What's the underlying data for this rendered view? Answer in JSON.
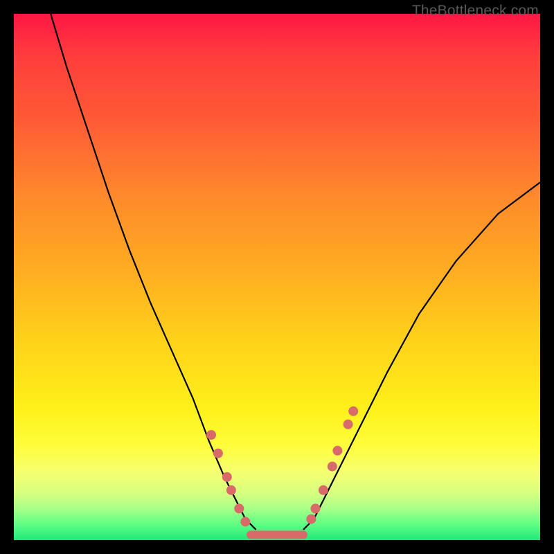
{
  "watermark": "TheBottleneck.com",
  "chart_data": {
    "type": "line",
    "title": "",
    "xlabel": "",
    "ylabel": "",
    "xlim": [
      0,
      100
    ],
    "ylim": [
      0,
      100
    ],
    "series": [
      {
        "name": "left-curve",
        "x": [
          7,
          10,
          14,
          18,
          22,
          26,
          30,
          34,
          37,
          40,
          42,
          44,
          46
        ],
        "y": [
          100,
          90,
          78,
          66,
          55,
          45,
          36,
          27,
          19,
          12,
          8,
          4,
          2
        ]
      },
      {
        "name": "right-curve",
        "x": [
          55,
          57,
          59,
          62,
          66,
          71,
          77,
          84,
          92,
          100
        ],
        "y": [
          2,
          4,
          8,
          14,
          22,
          32,
          43,
          53,
          62,
          68
        ]
      },
      {
        "name": "valley-floor",
        "x": [
          46,
          55
        ],
        "y": [
          0.5,
          0.5
        ]
      }
    ],
    "markers_left": [
      {
        "x": 37.5,
        "y": 20
      },
      {
        "x": 38.8,
        "y": 16.5
      },
      {
        "x": 40.5,
        "y": 12
      },
      {
        "x": 41.3,
        "y": 9.5
      },
      {
        "x": 42.8,
        "y": 6
      },
      {
        "x": 44.0,
        "y": 3.5
      }
    ],
    "markers_right": [
      {
        "x": 56.5,
        "y": 4
      },
      {
        "x": 57.3,
        "y": 6
      },
      {
        "x": 58.8,
        "y": 9.5
      },
      {
        "x": 60.5,
        "y": 14
      },
      {
        "x": 61.5,
        "y": 17
      },
      {
        "x": 63.5,
        "y": 22
      },
      {
        "x": 64.5,
        "y": 24.5
      }
    ],
    "flat_segment": {
      "x0": 45,
      "x1": 55,
      "y": 1
    },
    "colors": {
      "gradient_top": "#ff1744",
      "gradient_mid": "#ffd21a",
      "gradient_bottom": "#20e87a",
      "curve": "#000000",
      "marker": "#d86a6a",
      "background": "#000000"
    }
  }
}
